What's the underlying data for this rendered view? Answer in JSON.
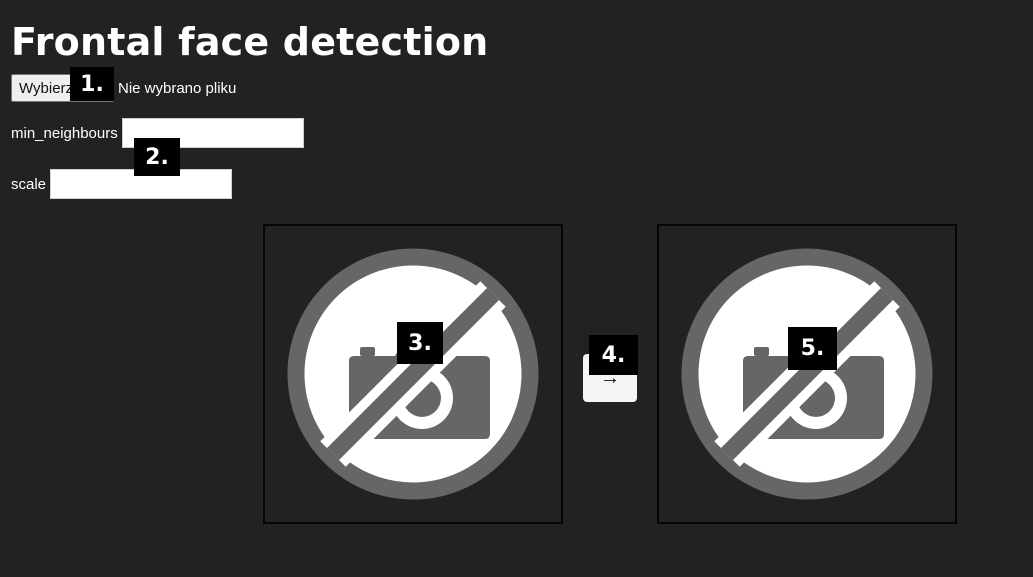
{
  "page": {
    "title": "Frontal face detection"
  },
  "file_input": {
    "button_label": "Wybierz plik",
    "status": "Nie wybrano pliku"
  },
  "params": {
    "min_neighbours": {
      "label": "min_neighbours",
      "value": ""
    },
    "scale": {
      "label": "scale",
      "value": ""
    }
  },
  "images": {
    "input_icon": "no-image-camera-icon",
    "output_icon": "no-image-camera-icon"
  },
  "process_button": {
    "label": "→"
  },
  "markers": [
    "1.",
    "2.",
    "3.",
    "4.",
    "5."
  ],
  "colors": {
    "background": "#222222",
    "placeholder_gray": "#666666",
    "marker_bg": "#000000"
  }
}
